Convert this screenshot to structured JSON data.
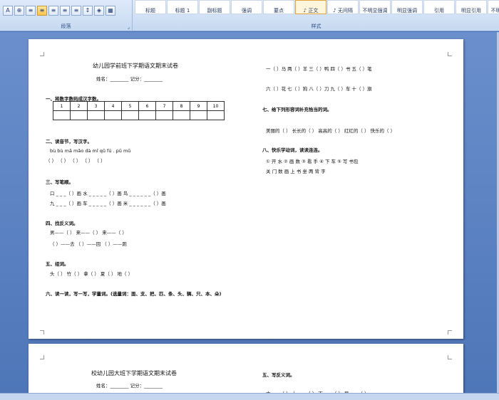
{
  "ribbon": {
    "paragraph_label": "段落",
    "styles_label": "样式",
    "styles": [
      "标题",
      "标题 1",
      "副标题",
      "强调",
      "要点",
      "♪ 正文",
      "♪ 无间隔",
      "不明显强调",
      "明显强调",
      "引用",
      "明显引用",
      "不明显参考"
    ]
  },
  "page1": {
    "title": "幼儿园学前班下学期语文期末试卷",
    "name_line": "姓名：________       记分：________",
    "s1": "一、将数字数码成汉字数。",
    "numbers": [
      "1",
      "2",
      "3",
      "4",
      "5",
      "6",
      "7",
      "8",
      "9",
      "10"
    ],
    "s2": "二、读音节，写汉字。",
    "s2_pinyin": "bù  bù               mǎ  mǎo                 dà  mǐ                  qǔ  fú                .  pǔ  mǔ",
    "s2_blanks": "（            ）       （            ）       （            ）       （            ）       （            ）",
    "s3": "三、写笔顺。",
    "s3_row1": "口 _ _ _（   ）画        水 _ _ _ _ _（   ）画        鸟 _ _ _ _ _ _（   ）画",
    "s3_row2": "九 _ _ _（   ）画        车 _ _ _ _ _（   ）画        米 _ _ _ _ _ _（   ）画",
    "s4": "四、找反义词。",
    "s4_row1": "男——（      ）                来——（      ）                 来——（      ）",
    "s4_row2": "（      ）——去              （      ）——回              （      ）——跑",
    "s5": "五、组词。",
    "s5_row": "头（         ）      竹（         ）      拿（         ）      夏（         ）      地（         ）",
    "s6": "六、读一读，写一写，学量词。(选量词：面、支、把、匹、条、头、辆、只、本、朵)",
    "r_row1": "一（   ）马      两（   ）羊      三（   ）鸭      四（   ）书      五（   ）笔",
    "r_row2": "六（   ）花      七（   ）狗      八（   ）刀      九（   ）车      十（   ）旗",
    "s7": "七、给下列形容词补充恰当的词。",
    "s7_row": "美丽的（        ）      长长的（        ）      高高的（        ）      红红的（        ）      快乐的（        ）",
    "s8": "八、快乐学动词，读读连连。",
    "s8_row1": "① 开        水        ② 画        数        ③ 看        手        ④ 下        车        ⑤ 写        书包",
    "s8_row2": "       关        门               数        画               上        书               坐        两               背        字"
  },
  "page2": {
    "title": "校幼儿园大班下学期语文期末试卷",
    "name_line": "姓名：________       记分：________",
    "s5": "五、写反义词。",
    "partial": "大——（      ）       上——（      ）       下——（      ）       早——（      ）"
  }
}
